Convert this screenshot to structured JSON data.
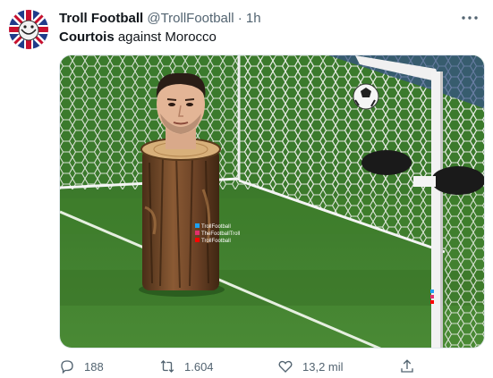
{
  "tweet": {
    "author_name": "Troll Football",
    "author_handle": "@TrollFootball",
    "separator": "·",
    "time": "1h",
    "text_bold": "Courtois",
    "text_rest": " against Morocco"
  },
  "watermark": {
    "line1": "TrollFootball",
    "line2": "TheFootballTroll",
    "line3": "TrollFootball"
  },
  "actions": {
    "reply_count": "188",
    "retweet_count": "1.604",
    "like_count": "13,2 mil"
  },
  "colors": {
    "text_primary": "#0f1419",
    "text_secondary": "#536471",
    "pitch_green": "#3f7e2c",
    "stump_brown": "#7a4f2e"
  },
  "icons": {
    "reply": "reply-icon",
    "retweet": "retweet-icon",
    "like": "like-icon",
    "share": "share-icon",
    "more": "more-icon"
  }
}
